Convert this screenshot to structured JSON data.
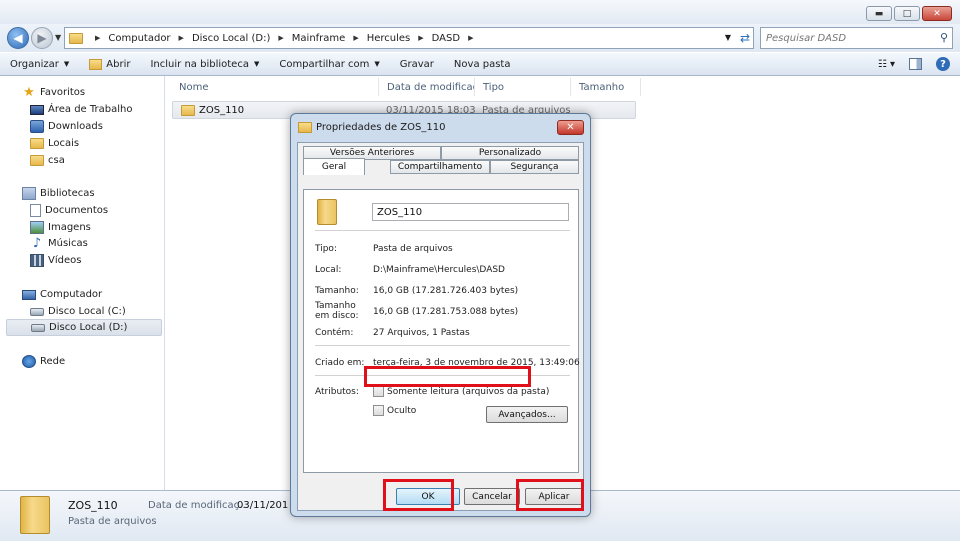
{
  "window": {
    "buttons": {
      "minimize": "▬",
      "maximize": "□",
      "close": "✕"
    }
  },
  "address": {
    "breadcrumbs": [
      "Computador",
      "Disco Local (D:)",
      "Mainframe",
      "Hercules",
      "DASD"
    ],
    "search_placeholder": "Pesquisar DASD"
  },
  "toolbar": {
    "organize": "Organizar",
    "open": "Abrir",
    "include_library": "Incluir na biblioteca",
    "share": "Compartilhar com",
    "burn": "Gravar",
    "new_folder": "Nova pasta"
  },
  "sidebar": {
    "favorites": {
      "label": "Favoritos",
      "items": [
        "Área de Trabalho",
        "Downloads",
        "Locais",
        "csa"
      ]
    },
    "libraries": {
      "label": "Bibliotecas",
      "items": [
        "Documentos",
        "Imagens",
        "Músicas",
        "Vídeos"
      ]
    },
    "computer": {
      "label": "Computador",
      "items": [
        "Disco Local (C:)",
        "Disco Local (D:)"
      ]
    },
    "network": {
      "label": "Rede"
    }
  },
  "filelist": {
    "columns": [
      "Nome",
      "Data de modificaç...",
      "Tipo",
      "Tamanho"
    ],
    "rows": [
      {
        "name": "ZOS_110",
        "date": "03/11/2015 18:03",
        "type": "Pasta de arquivos"
      }
    ]
  },
  "details": {
    "name": "ZOS_110",
    "type": "Pasta de arquivos",
    "date_label": "Data de modificaç...",
    "date_value": "03/11/2015 1"
  },
  "dialog": {
    "title": "Propriedades de ZOS_110",
    "close": "✕",
    "tabs_back": [
      "Versões Anteriores",
      "Personalizado"
    ],
    "tabs_front": [
      "Geral",
      "Compartilhamento",
      "Segurança"
    ],
    "folder_name": "ZOS_110",
    "props": {
      "type_label": "Tipo:",
      "type_value": "Pasta de arquivos",
      "location_label": "Local:",
      "location_value": "D:\\Mainframe\\Hercules\\DASD",
      "size_label": "Tamanho:",
      "size_value": "16,0 GB (17.281.726.403 bytes)",
      "disk_size_label": "Tamanho em disco:",
      "disk_size_value": "16,0 GB (17.281.753.088 bytes)",
      "contains_label": "Contém:",
      "contains_value": "27 Arquivos, 1 Pastas",
      "created_label": "Criado em:",
      "created_value": "terça-feira, 3 de novembro de 2015, 13:49:06",
      "attributes_label": "Atributos:"
    },
    "readonly_label": "Somente leitura (arquivos da pasta)",
    "hidden_label": "Oculto",
    "advanced_button": "Avançados...",
    "ok_button": "OK",
    "cancel_button": "Cancelar",
    "apply_button": "Aplicar"
  }
}
